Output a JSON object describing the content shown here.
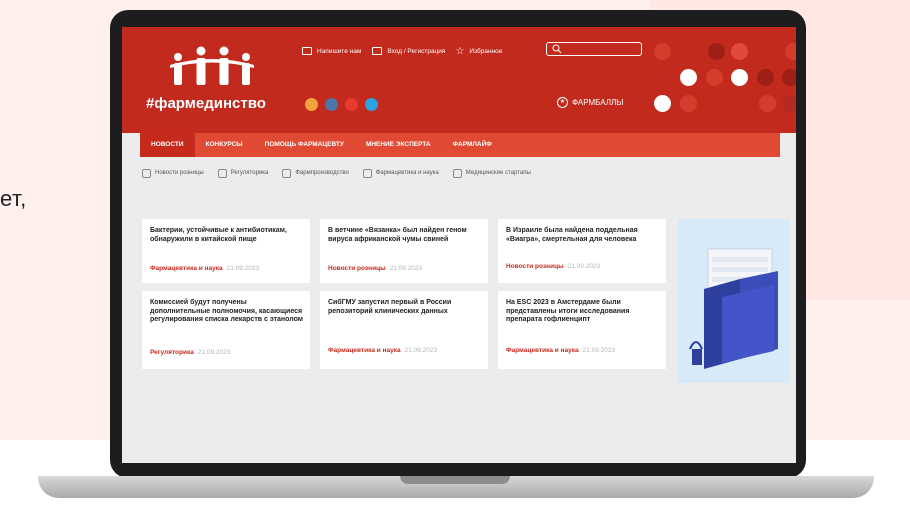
{
  "side_text": "ет,",
  "site": {
    "logo_text": "#фармединство",
    "top_links": [
      {
        "label": "Напишите нам",
        "icon": "envelope-icon"
      },
      {
        "label": "Вход / Регистрация",
        "icon": "id-card-icon"
      },
      {
        "label": "Избранное",
        "icon": "star-icon"
      }
    ],
    "search_icon": "search-icon",
    "social": [
      "ok-icon",
      "vk-icon",
      "youtube-icon",
      "telegram-icon"
    ],
    "farmbally_label": "ФАРМБАЛЛЫ",
    "nav": [
      {
        "label": "НОВОСТИ",
        "active": true
      },
      {
        "label": "КОНКУРСЫ",
        "active": false
      },
      {
        "label": "ПОМОЩЬ ФАРМАЦЕВТУ",
        "active": false
      },
      {
        "label": "МНЕНИЕ ЭКСПЕРТА",
        "active": false
      },
      {
        "label": "ФАРМЛАЙФ",
        "active": false
      }
    ],
    "subnav": [
      {
        "label": "Новости розницы"
      },
      {
        "label": "Регуляторика"
      },
      {
        "label": "Фармпроизводство"
      },
      {
        "label": "Фармацевтика и наука"
      },
      {
        "label": "Медицинские стартапы"
      }
    ],
    "cards": [
      {
        "title": "Бактерии, устойчивые к антибиотикам, обнаружили в китайской пище",
        "category": "Фармацевтика и наука",
        "date": "21.09.2023"
      },
      {
        "title": "В ветчине «Вязанка» был найден геном вируса африканской чумы свиней",
        "category": "Новости розницы",
        "date": "21.09.2023"
      },
      {
        "title": "В Израиле была найдена поддельная «Виагра», смертельная для человека",
        "category": "Новости розницы",
        "date": "21.09.2023"
      },
      {
        "title": "Комиссией будут получены дополнительные полномочия, касающиеся регулирования списка лекарств с этанолом",
        "category": "Регуляторика",
        "date": "21.09.2023"
      },
      {
        "title": "СибГМУ запустил первый в России репозиторий клинических данных",
        "category": "Фармацевтика и наука",
        "date": "21.09.2023"
      },
      {
        "title": "На ESC 2023 в Амстердаме были представлены итоги исследования препарата гофлиенципт",
        "category": "Фармацевтика и наука",
        "date": "21.09.2023"
      }
    ],
    "colors": {
      "header": "#c12a1d",
      "nav": "#e04a34",
      "accent": "#c62a1c"
    }
  }
}
